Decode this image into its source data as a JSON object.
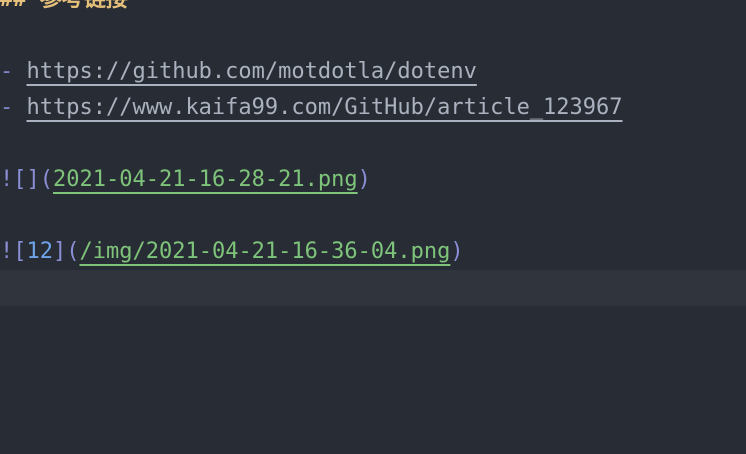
{
  "heading": {
    "mark": "##",
    "text": "参考链接"
  },
  "list": {
    "bullet": "-",
    "items": [
      {
        "url": "https://github.com/motdotla/dotenv"
      },
      {
        "url": "https://www.kaifa99.com/GitHub/article_123967"
      }
    ]
  },
  "images": [
    {
      "bang": "!",
      "open_bracket": "[",
      "alt": "",
      "close_bracket": "]",
      "open_paren": "(",
      "path": "2021-04-21-16-28-21.png",
      "close_paren": ")"
    },
    {
      "bang": "!",
      "open_bracket": "[",
      "alt": "12",
      "close_bracket": "]",
      "open_paren": "(",
      "path": "/img/2021-04-21-16-36-04.png",
      "close_paren": ")"
    }
  ]
}
